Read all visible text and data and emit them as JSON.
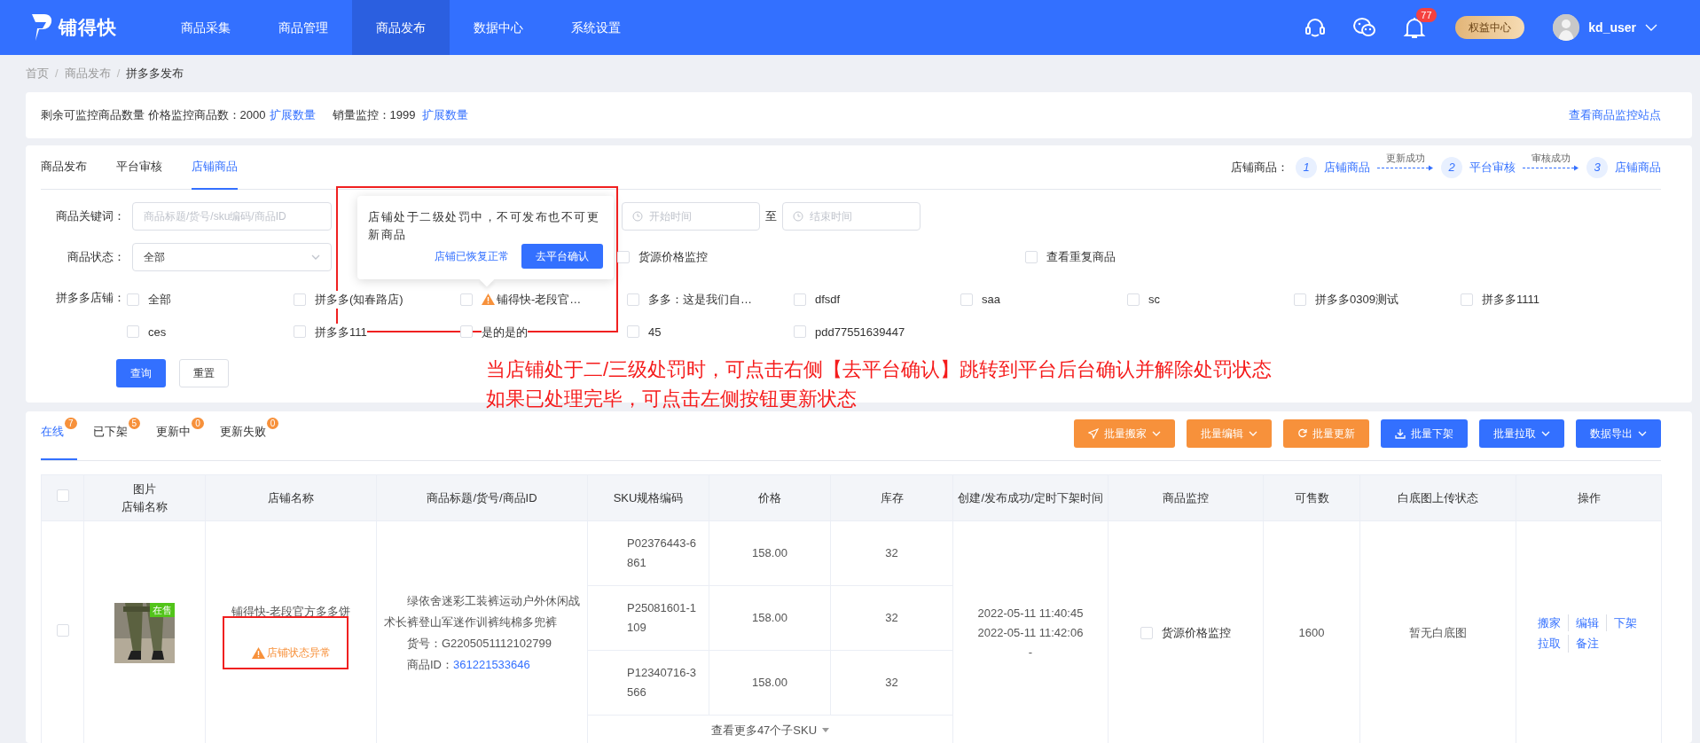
{
  "nav": {
    "logo": "铺得快",
    "items": [
      {
        "label": "商品采集",
        "selected": false
      },
      {
        "label": "商品管理",
        "selected": false
      },
      {
        "label": "商品发布",
        "selected": true
      },
      {
        "label": "数据中心",
        "selected": false
      },
      {
        "label": "系统设置",
        "selected": false
      }
    ],
    "notification_count": "77",
    "benefits": "权益中心",
    "user": "kd_user"
  },
  "breadcrumb": [
    {
      "label": "首页"
    },
    {
      "label": "商品发布"
    },
    {
      "label": "拼多多发布"
    }
  ],
  "breadcrumb_separators": [
    "/",
    "/"
  ],
  "quota": {
    "price_text": "剩余可监控商品数量 价格监控商品数：2000",
    "price_link": "扩展数量",
    "sales_text": "销量监控：1999",
    "sales_link": "扩展数量",
    "site_link": "查看商品监控站点"
  },
  "filter": {
    "tabs": [
      {
        "label": "商品发布",
        "selected": false
      },
      {
        "label": "平台审核",
        "selected": false
      },
      {
        "label": "店铺商品",
        "selected": true
      }
    ],
    "steps_label": "店铺商品：",
    "steps": [
      {
        "number": "1",
        "label": "店铺商品"
      },
      {
        "number": "2",
        "label": "平台审核"
      },
      {
        "number": "3",
        "label": "店铺商品"
      }
    ],
    "step_arrows": [
      "更新成功",
      "审核成功"
    ],
    "keyword_label": "商品关键词：",
    "keyword_placeholder": "商品标题/货号/sku编码/商品ID",
    "start_placeholder": "开始时间",
    "range_separator": "至",
    "end_placeholder": "结束时间",
    "status_label": "商品状态：",
    "status_value": "全部",
    "options": [
      {
        "label": "货源价格监控",
        "checked": false
      },
      {
        "label": "查看重复商品",
        "checked": false
      }
    ],
    "shops_label": "拼多多店铺：",
    "shops": [
      {
        "label": "全部",
        "checked": false,
        "warning": false
      },
      {
        "label": "拼多多(知春路店)",
        "checked": false,
        "warning": false
      },
      {
        "label": "铺得快-老段官…",
        "checked": false,
        "warning": true
      },
      {
        "label": "多多：这是我们自…",
        "checked": false,
        "warning": false
      },
      {
        "label": "dfsdf",
        "checked": false,
        "warning": false
      },
      {
        "label": "saa",
        "checked": false,
        "warning": false
      },
      {
        "label": "sc",
        "checked": false,
        "warning": false
      },
      {
        "label": "拼多多0309测试",
        "checked": false,
        "warning": false
      },
      {
        "label": "拼多多1111",
        "checked": false,
        "warning": false
      },
      {
        "label": "ces",
        "checked": false,
        "warning": false
      },
      {
        "label": "拼多多111",
        "checked": false,
        "warning": false
      },
      {
        "label": "是的是的",
        "checked": false,
        "warning": false
      },
      {
        "label": "45",
        "checked": false,
        "warning": false
      },
      {
        "label": "pdd77551639447",
        "checked": false,
        "warning": false
      }
    ],
    "query": "查询",
    "reset": "重置"
  },
  "popup": {
    "message": "店铺处于二级处罚中，不可发布也不可更新商品",
    "restored": "店铺已恢复正常",
    "confirm": "去平台确认"
  },
  "annotation": [
    "当店铺处于二/三级处罚时，可点击右侧【去平台确认】跳转到平台后台确认并解除处罚状态",
    "如果已处理完毕，可点击左侧按钮更新状态"
  ],
  "list": {
    "tabs": [
      {
        "label": "在线",
        "count": "7",
        "selected": true
      },
      {
        "label": "已下架",
        "count": "5",
        "selected": false
      },
      {
        "label": "更新中",
        "count": "0",
        "selected": false
      },
      {
        "label": "更新失败",
        "count": "0",
        "selected": false
      }
    ],
    "actions": [
      {
        "label": "批量搬家",
        "color": "#f7913b",
        "dropdown": true
      },
      {
        "label": "批量编辑",
        "color": "#f7913b",
        "dropdown": true
      },
      {
        "label": "批量更新",
        "color": "#f7913b",
        "dropdown": false
      },
      {
        "label": "批量下架",
        "color": "#3370ff",
        "dropdown": false
      },
      {
        "label": "批量拉取",
        "color": "#3370ff",
        "dropdown": true
      },
      {
        "label": "数据导出",
        "color": "#3370ff",
        "dropdown": true
      }
    ],
    "select_all_checked": false,
    "picture_column": [
      "图片",
      "店铺名称"
    ],
    "columns": [
      "店铺名称",
      "商品标题/货号/商品ID",
      "SKU规格编码",
      "价格",
      "库存",
      "创建/发布成功/定时下架时间",
      "商品监控",
      "可售数",
      "白底图上传状态",
      "操作"
    ],
    "rows": [
      {
        "checked": false,
        "picture_badge": "在售",
        "shop": "铺得快-老段官方多多饼",
        "shop_warning": "店铺状态异常",
        "title": "绿依舍迷彩工装裤运动户外休闲战术长裤登山军迷作训裤纯棉多兜裤",
        "item_no": "货号：G2205051112102799",
        "product_id_label": "商品ID：",
        "product_id": "361221533646",
        "skus": [
          {
            "code": "P02376443-6861",
            "price": "158.00",
            "stock": "32"
          },
          {
            "code": "P25081601-1109",
            "price": "158.00",
            "stock": "32"
          },
          {
            "code": "P12340716-3566",
            "price": "158.00",
            "stock": "32"
          }
        ],
        "more_skus": "查看更多47个子SKU",
        "times": [
          "2022-05-11 11:40:45",
          "2022-05-11 11:42:06",
          "-"
        ],
        "monitor": {
          "label": "货源价格监控",
          "checked": false
        },
        "sellable": "1600",
        "white_image": "暂无白底图",
        "operations": [
          "搬家",
          "编辑",
          "下架",
          "拉取",
          "备注"
        ]
      }
    ]
  }
}
